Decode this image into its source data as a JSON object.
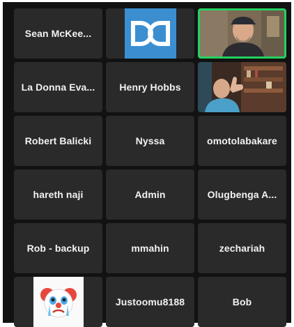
{
  "participants": [
    {
      "name": "Sean McKee..."
    },
    {
      "name": "",
      "icon": "dolby-logo-icon",
      "color": "#3b8fd1"
    },
    {
      "name": "",
      "icon": "video-feed-man-cap",
      "active_speaker": true,
      "border_color": "#23d160"
    },
    {
      "name": "La Donna Eva..."
    },
    {
      "name": "Henry Hobbs"
    },
    {
      "name": "",
      "icon": "video-feed-thumbs-up"
    },
    {
      "name": "Robert Balicki"
    },
    {
      "name": "Nyssa"
    },
    {
      "name": "omotolabakare"
    },
    {
      "name": "hareth naji"
    },
    {
      "name": "Admin"
    },
    {
      "name": "Olugbenga A..."
    },
    {
      "name": "Rob - backup"
    },
    {
      "name": "mmahin"
    },
    {
      "name": "zechariah"
    },
    {
      "name": "",
      "icon": "crying-clown-avatar-icon"
    },
    {
      "name": "Justoomu8188"
    },
    {
      "name": "Bob"
    }
  ]
}
